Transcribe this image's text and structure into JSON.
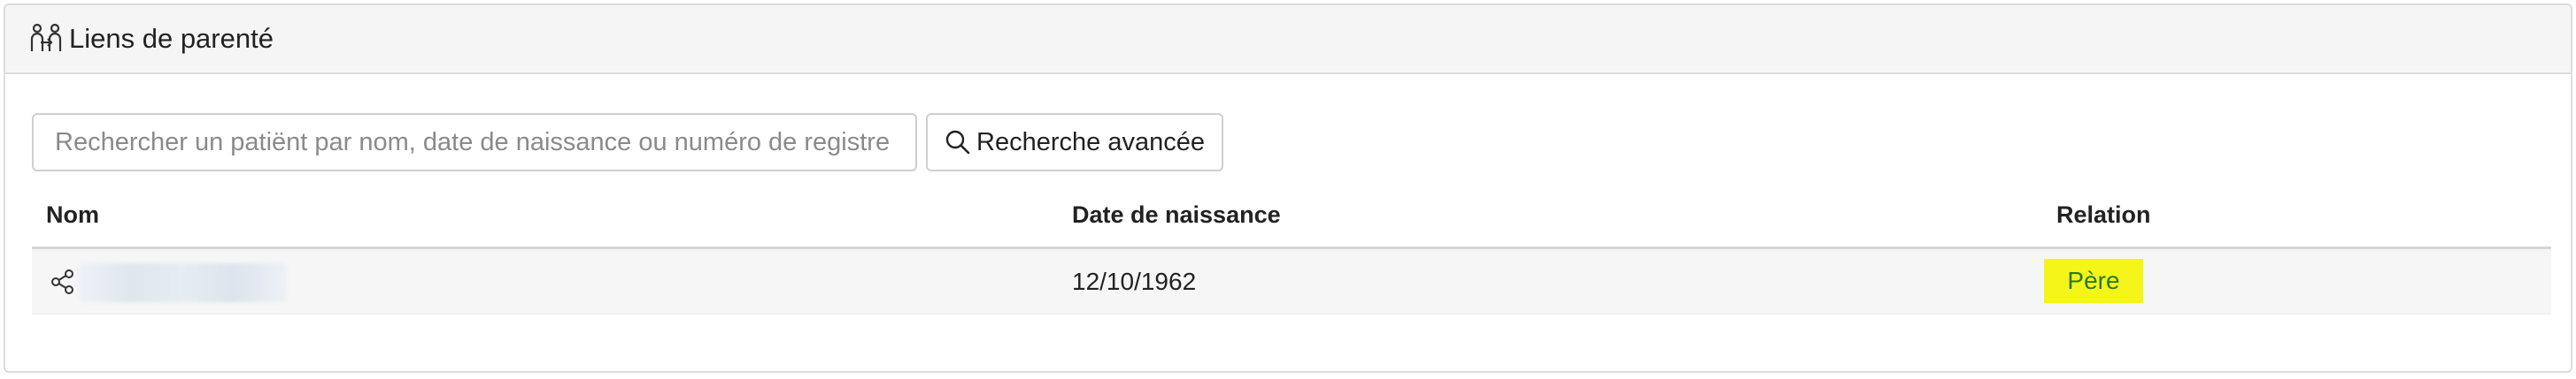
{
  "panel": {
    "title": "Liens de parenté",
    "icon": "family-link-icon"
  },
  "search": {
    "placeholder": "Rechercher un patiënt par nom, date de naissance ou numéro de registre national",
    "value": "",
    "advanced_label": "Recherche avancée",
    "advanced_icon": "search-icon"
  },
  "table": {
    "columns": [
      "Nom",
      "Date de naissance",
      "Relation"
    ],
    "rows": [
      {
        "name": "",
        "birthdate": "12/10/1962",
        "relation": "Père",
        "row_icon": "share-icon"
      }
    ]
  },
  "colors": {
    "relation_highlight": "#f5f51a",
    "relation_text": "#2a7a2a"
  }
}
